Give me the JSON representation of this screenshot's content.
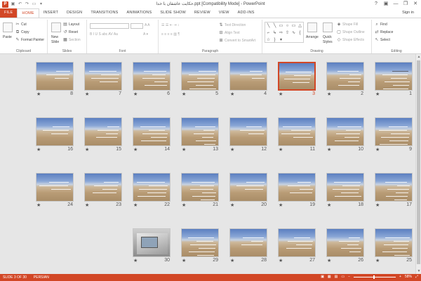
{
  "app": {
    "window_title": "حکایت عاشقان با خدا.ppt [Compatibility Mode] - PowerPoint",
    "sign_in": "Sign in",
    "logo": "P"
  },
  "tabs": [
    "FILE",
    "HOME",
    "INSERT",
    "DESIGN",
    "TRANSITIONS",
    "ANIMATIONS",
    "SLIDE SHOW",
    "REVIEW",
    "VIEW",
    "ADD-INS"
  ],
  "active_tab": "HOME",
  "ribbon": {
    "clipboard": {
      "label": "Clipboard",
      "paste": "Paste",
      "cut": "Cut",
      "copy": "Copy",
      "format_painter": "Format Painter"
    },
    "slides": {
      "label": "Slides",
      "new_slide": "New",
      "new_slide2": "Slide",
      "layout": "Layout",
      "reset": "Reset",
      "section": "Section"
    },
    "font": {
      "label": "Font"
    },
    "paragraph": {
      "label": "Paragraph",
      "text_direction": "Text Direction",
      "align_text": "Align Text",
      "convert": "Convert to SmartArt"
    },
    "drawing": {
      "label": "Drawing",
      "arrange": "Arrange",
      "quick_styles": "Quick",
      "quick_styles2": "Styles",
      "shape_fill": "Shape Fill",
      "shape_outline": "Shape Outline",
      "shape_effects": "Shape Effects"
    },
    "editing": {
      "label": "Editing",
      "find": "Find",
      "replace": "Replace",
      "select": "Select"
    }
  },
  "slides": {
    "selected": 3,
    "rows": [
      [
        8,
        7,
        6,
        5,
        4,
        3,
        2,
        1
      ],
      [
        16,
        15,
        14,
        13,
        12,
        11,
        10,
        9
      ],
      [
        24,
        23,
        22,
        21,
        20,
        19,
        18,
        17
      ],
      [
        30,
        29,
        28,
        27,
        26,
        25
      ]
    ],
    "star": "★"
  },
  "status": {
    "slide_info": "SLIDE 3 OF 30",
    "language": "PERSIAN",
    "zoom": "58%"
  },
  "colors": {
    "accent": "#d24726",
    "selected_border": "#d24726"
  }
}
